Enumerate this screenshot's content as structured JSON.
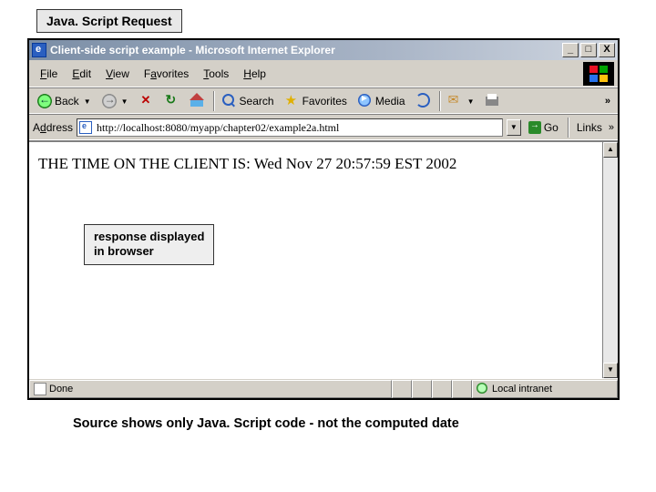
{
  "slide_label": "Java. Script Request",
  "titlebar": {
    "text": "Client-side script example - Microsoft Internet Explorer"
  },
  "window_controls": {
    "minimize": "_",
    "maximize": "□",
    "close": "X"
  },
  "menubar": {
    "file": "File",
    "edit": "Edit",
    "view": "View",
    "favorites": "Favorites",
    "tools": "Tools",
    "help": "Help"
  },
  "toolbar": {
    "back": "Back",
    "search": "Search",
    "favorites": "Favorites",
    "media": "Media",
    "overflow": "»"
  },
  "addressbar": {
    "label": "Address",
    "value": "http://localhost:8080/myapp/chapter02/example2a.html",
    "go": "Go",
    "links": "Links",
    "overflow": "»"
  },
  "page": {
    "content": "THE TIME ON THE CLIENT IS: Wed Nov 27 20:57:59 EST 2002"
  },
  "callout": {
    "line1": "response displayed",
    "line2": "in browser"
  },
  "statusbar": {
    "done": "Done",
    "zone": "Local intranet"
  },
  "scroll": {
    "up": "▲",
    "down": "▼"
  },
  "footer": "Source shows only Java. Script code - not the computed date"
}
